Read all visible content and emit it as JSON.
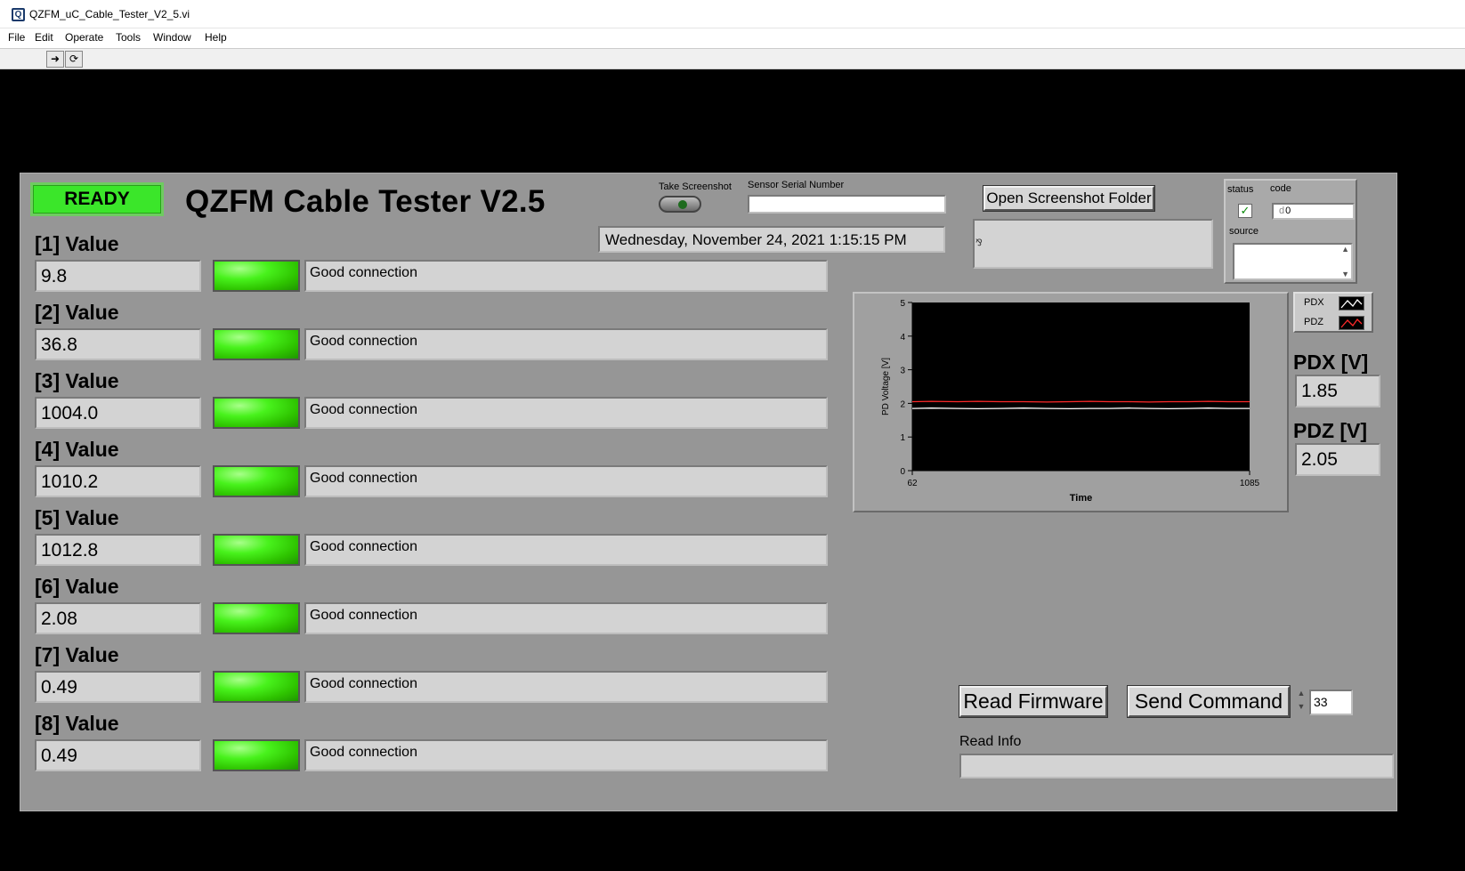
{
  "window": {
    "title": "QZFM_uC_Cable_Tester_V2_5.vi",
    "menu": [
      "File",
      "Edit",
      "Operate",
      "Tools",
      "Window",
      "Help"
    ],
    "toolbar": {
      "run_icon": "run-arrow-icon",
      "run_continuous_icon": "run-continuously-icon"
    }
  },
  "header": {
    "ready_label": "READY",
    "title": "QZFM Cable Tester V2.5",
    "take_screenshot_label": "Take Screenshot",
    "sensor_serial_label": "Sensor Serial Number",
    "sensor_serial_value": "",
    "datetime": "Wednesday, November 24, 2021   1:15:15 PM",
    "open_folder_label": "Open Screenshot Folder",
    "path_value": ""
  },
  "error_cluster": {
    "status_label": "status",
    "code_label": "code",
    "code_value": "0",
    "code_prefix": "d",
    "source_label": "source",
    "source_value": ""
  },
  "channels": [
    {
      "label": "[1] Value",
      "value": "9.8",
      "status": "Good connection"
    },
    {
      "label": "[2] Value",
      "value": "36.8",
      "status": "Good connection"
    },
    {
      "label": "[3] Value",
      "value": "1004.0",
      "status": "Good connection"
    },
    {
      "label": "[4] Value",
      "value": "1010.2",
      "status": "Good connection"
    },
    {
      "label": "[5] Value",
      "value": "1012.8",
      "status": "Good connection"
    },
    {
      "label": "[6] Value",
      "value": "2.08",
      "status": "Good connection"
    },
    {
      "label": "[7] Value",
      "value": "0.49",
      "status": "Good connection"
    },
    {
      "label": "[8] Value",
      "value": "0.49",
      "status": "Good connection"
    }
  ],
  "readouts": {
    "pdx_label": "PDX [V]",
    "pdx_value": "1.85",
    "pdz_label": "PDZ [V]",
    "pdz_value": "2.05"
  },
  "controls": {
    "read_firmware_label": "Read Firmware",
    "send_command_label": "Send Command",
    "command_value": "33",
    "read_info_label": "Read Info",
    "read_info_value": ""
  },
  "colors": {
    "panel": "#969696",
    "led_green": "#3be62a",
    "pdx_line": "#ffffff",
    "pdz_line": "#ff2a2a",
    "plot_bg": "#000000"
  },
  "chart_data": {
    "type": "line",
    "title": "",
    "xlabel": "Time",
    "ylabel": "PD Voltage [V]",
    "xlim": [
      62,
      1085
    ],
    "ylim": [
      0,
      5
    ],
    "x_ticks": [
      62,
      1085
    ],
    "y_ticks": [
      0,
      1,
      2,
      3,
      4,
      5
    ],
    "grid": false,
    "legend": "top-right outside",
    "series": [
      {
        "name": "PDX",
        "color": "#ffffff",
        "x": [
          62,
          120,
          200,
          260,
          330,
          400,
          470,
          540,
          600,
          660,
          720,
          780,
          840,
          900,
          960,
          1020,
          1085
        ],
        "y": [
          1.85,
          1.86,
          1.85,
          1.84,
          1.85,
          1.86,
          1.85,
          1.84,
          1.85,
          1.85,
          1.86,
          1.85,
          1.84,
          1.85,
          1.86,
          1.85,
          1.85
        ]
      },
      {
        "name": "PDZ",
        "color": "#ff2a2a",
        "x": [
          62,
          120,
          200,
          260,
          330,
          400,
          470,
          540,
          600,
          660,
          720,
          780,
          840,
          900,
          960,
          1020,
          1085
        ],
        "y": [
          2.05,
          2.06,
          2.05,
          2.06,
          2.05,
          2.05,
          2.04,
          2.05,
          2.06,
          2.05,
          2.05,
          2.04,
          2.05,
          2.05,
          2.06,
          2.05,
          2.05
        ]
      }
    ]
  }
}
